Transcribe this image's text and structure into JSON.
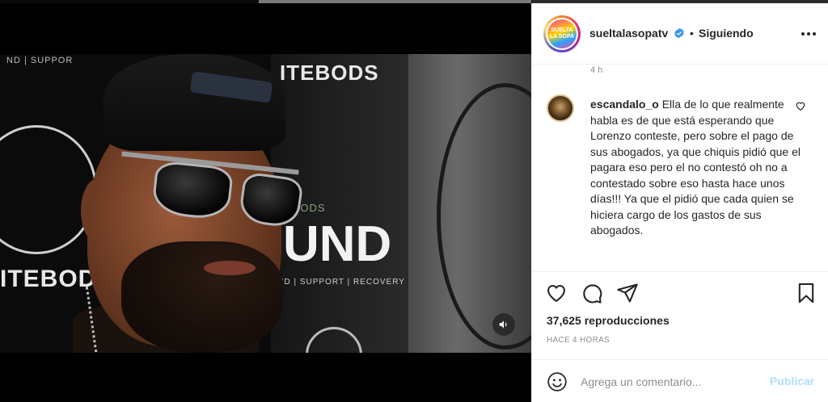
{
  "post": {
    "username": "sueltalasopatv",
    "verified_icon": "verified-badge-icon",
    "separator": "•",
    "follow_state": "Siguiendo",
    "avatar_text": "SUELTA LA SOPA",
    "more_icon": "more-options-icon",
    "previous_comment_time": "4 h"
  },
  "video": {
    "brand_support": "ND | SUPPOR",
    "brand_itebods_top": "ITEBODS",
    "brand_itebods_left": "ITEBOD",
    "brand_ebods": "EBODS",
    "brand_ound": "UND",
    "brand_recovery": "AID | SUPPORT | RECOVERY",
    "mute_icon": "speaker-icon"
  },
  "comment": {
    "username": "escandalo_o",
    "text": "Ella de lo que realmente habla es de que está esperando que Lorenzo conteste, pero sobre el pago de sus abogados, ya que chiquis pidió que el pagara eso pero el no contestó oh no a contestado sobre eso hasta hace unos días!!! Ya que el pidió que cada quien se hiciera cargo de los gastos de sus abogados.",
    "like_icon": "heart-outline-icon"
  },
  "actions": {
    "like_icon": "heart-icon",
    "comment_icon": "comment-icon",
    "share_icon": "paper-plane-icon",
    "save_icon": "bookmark-icon",
    "views": "37,625 reproducciones",
    "time_ago": "HACE 4 HORAS"
  },
  "add_comment": {
    "emoji_icon": "emoji-icon",
    "placeholder": "Agrega un comentario...",
    "publish_label": "Publicar"
  },
  "colors": {
    "accent_publish_disabled": "#b2dffc",
    "verified_blue": "#3897f0",
    "text_primary": "#262626",
    "text_secondary": "#8e8e8e"
  }
}
